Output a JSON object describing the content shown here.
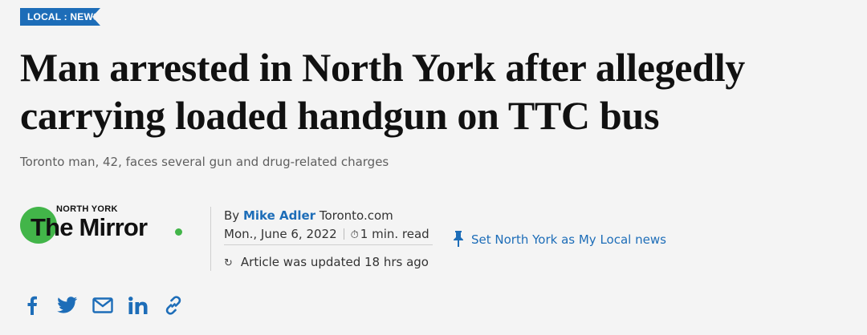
{
  "section_tag": "LOCAL : NEWS",
  "headline": "Man arrested in North York after allegedly carrying loaded handgun on TTC bus",
  "subheadline": "Toronto man, 42, faces several gun and drug-related charges",
  "logo": {
    "kicker": "NORTH YORK",
    "name": "The Mirror"
  },
  "byline": {
    "prefix": "By",
    "author": "Mike Adler",
    "outlet": "Toronto.com"
  },
  "dateline": {
    "date": "Mon., June 6, 2022",
    "read_time": "1 min. read"
  },
  "updated": "Article was updated 18 hrs ago",
  "set_local": "Set North York as My Local news",
  "share_icons": [
    "facebook-icon",
    "twitter-icon",
    "email-icon",
    "linkedin-icon",
    "link-icon"
  ],
  "colors": {
    "accent": "#1d6db8",
    "brand_green": "#42b549",
    "background": "#f4f4f4"
  }
}
